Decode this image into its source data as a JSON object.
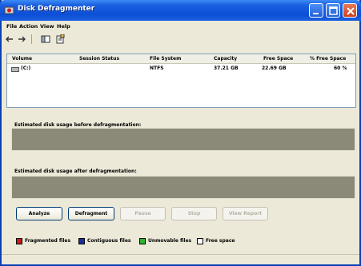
{
  "window": {
    "title": "Disk Defragmenter"
  },
  "menu": [
    "File",
    "Action",
    "View",
    "Help"
  ],
  "toolbar": {
    "icons": [
      "back-icon",
      "forward-icon",
      "console-tree-icon",
      "properties-icon"
    ]
  },
  "volumes": {
    "columns": [
      "Volume",
      "Session Status",
      "File System",
      "Capacity",
      "Free Space",
      "% Free Space"
    ],
    "rows": [
      {
        "volume": "(C:)",
        "session_status": "",
        "file_system": "NTFS",
        "capacity": "37.21 GB",
        "free_space": "22.69 GB",
        "pct_free": "60 %"
      }
    ]
  },
  "analysis": {
    "before_label": "Estimated disk usage before defragmentation:",
    "after_label": "Estimated disk usage after defragmentation:"
  },
  "buttons": {
    "analyze": "Analyze",
    "defragment": "Defragment",
    "pause": "Pause",
    "stop": "Stop",
    "view_report": "View Report"
  },
  "legend": [
    {
      "label": "Fragmented files",
      "color": "#c81d1d"
    },
    {
      "label": "Contiguous files",
      "color": "#1b2fa0"
    },
    {
      "label": "Unmovable files",
      "color": "#2fb32f"
    },
    {
      "label": "Free space",
      "color": "#ffffff"
    }
  ],
  "colors": {
    "titlebar": "#0c4fd6",
    "map_background": "#8b8a79",
    "window": "#ece9d8"
  }
}
